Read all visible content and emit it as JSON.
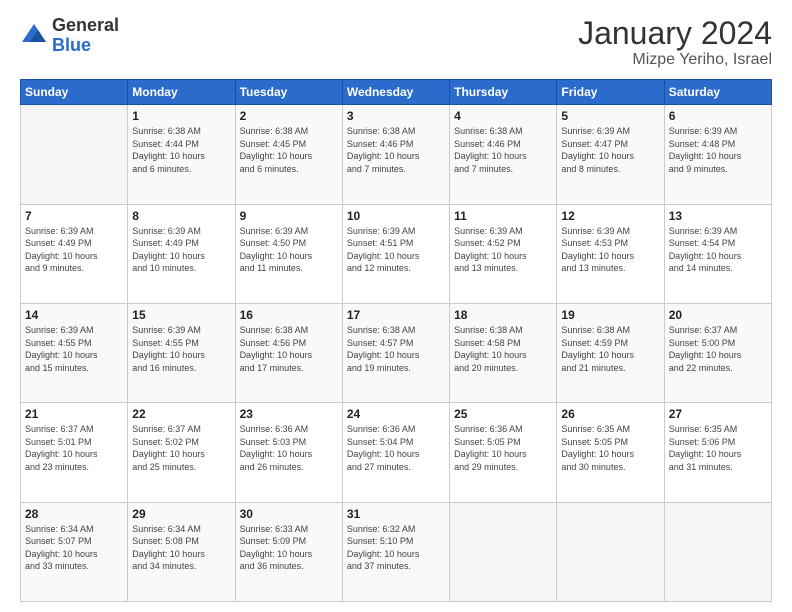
{
  "logo": {
    "general": "General",
    "blue": "Blue"
  },
  "title": {
    "month_year": "January 2024",
    "location": "Mizpe Yeriho, Israel"
  },
  "days_of_week": [
    "Sunday",
    "Monday",
    "Tuesday",
    "Wednesday",
    "Thursday",
    "Friday",
    "Saturday"
  ],
  "weeks": [
    [
      {
        "day": "",
        "info": ""
      },
      {
        "day": "1",
        "info": "Sunrise: 6:38 AM\nSunset: 4:44 PM\nDaylight: 10 hours\nand 6 minutes."
      },
      {
        "day": "2",
        "info": "Sunrise: 6:38 AM\nSunset: 4:45 PM\nDaylight: 10 hours\nand 6 minutes."
      },
      {
        "day": "3",
        "info": "Sunrise: 6:38 AM\nSunset: 4:46 PM\nDaylight: 10 hours\nand 7 minutes."
      },
      {
        "day": "4",
        "info": "Sunrise: 6:38 AM\nSunset: 4:46 PM\nDaylight: 10 hours\nand 7 minutes."
      },
      {
        "day": "5",
        "info": "Sunrise: 6:39 AM\nSunset: 4:47 PM\nDaylight: 10 hours\nand 8 minutes."
      },
      {
        "day": "6",
        "info": "Sunrise: 6:39 AM\nSunset: 4:48 PM\nDaylight: 10 hours\nand 9 minutes."
      }
    ],
    [
      {
        "day": "7",
        "info": "Sunrise: 6:39 AM\nSunset: 4:49 PM\nDaylight: 10 hours\nand 9 minutes."
      },
      {
        "day": "8",
        "info": "Sunrise: 6:39 AM\nSunset: 4:49 PM\nDaylight: 10 hours\nand 10 minutes."
      },
      {
        "day": "9",
        "info": "Sunrise: 6:39 AM\nSunset: 4:50 PM\nDaylight: 10 hours\nand 11 minutes."
      },
      {
        "day": "10",
        "info": "Sunrise: 6:39 AM\nSunset: 4:51 PM\nDaylight: 10 hours\nand 12 minutes."
      },
      {
        "day": "11",
        "info": "Sunrise: 6:39 AM\nSunset: 4:52 PM\nDaylight: 10 hours\nand 13 minutes."
      },
      {
        "day": "12",
        "info": "Sunrise: 6:39 AM\nSunset: 4:53 PM\nDaylight: 10 hours\nand 13 minutes."
      },
      {
        "day": "13",
        "info": "Sunrise: 6:39 AM\nSunset: 4:54 PM\nDaylight: 10 hours\nand 14 minutes."
      }
    ],
    [
      {
        "day": "14",
        "info": "Sunrise: 6:39 AM\nSunset: 4:55 PM\nDaylight: 10 hours\nand 15 minutes."
      },
      {
        "day": "15",
        "info": "Sunrise: 6:39 AM\nSunset: 4:55 PM\nDaylight: 10 hours\nand 16 minutes."
      },
      {
        "day": "16",
        "info": "Sunrise: 6:38 AM\nSunset: 4:56 PM\nDaylight: 10 hours\nand 17 minutes."
      },
      {
        "day": "17",
        "info": "Sunrise: 6:38 AM\nSunset: 4:57 PM\nDaylight: 10 hours\nand 19 minutes."
      },
      {
        "day": "18",
        "info": "Sunrise: 6:38 AM\nSunset: 4:58 PM\nDaylight: 10 hours\nand 20 minutes."
      },
      {
        "day": "19",
        "info": "Sunrise: 6:38 AM\nSunset: 4:59 PM\nDaylight: 10 hours\nand 21 minutes."
      },
      {
        "day": "20",
        "info": "Sunrise: 6:37 AM\nSunset: 5:00 PM\nDaylight: 10 hours\nand 22 minutes."
      }
    ],
    [
      {
        "day": "21",
        "info": "Sunrise: 6:37 AM\nSunset: 5:01 PM\nDaylight: 10 hours\nand 23 minutes."
      },
      {
        "day": "22",
        "info": "Sunrise: 6:37 AM\nSunset: 5:02 PM\nDaylight: 10 hours\nand 25 minutes."
      },
      {
        "day": "23",
        "info": "Sunrise: 6:36 AM\nSunset: 5:03 PM\nDaylight: 10 hours\nand 26 minutes."
      },
      {
        "day": "24",
        "info": "Sunrise: 6:36 AM\nSunset: 5:04 PM\nDaylight: 10 hours\nand 27 minutes."
      },
      {
        "day": "25",
        "info": "Sunrise: 6:36 AM\nSunset: 5:05 PM\nDaylight: 10 hours\nand 29 minutes."
      },
      {
        "day": "26",
        "info": "Sunrise: 6:35 AM\nSunset: 5:05 PM\nDaylight: 10 hours\nand 30 minutes."
      },
      {
        "day": "27",
        "info": "Sunrise: 6:35 AM\nSunset: 5:06 PM\nDaylight: 10 hours\nand 31 minutes."
      }
    ],
    [
      {
        "day": "28",
        "info": "Sunrise: 6:34 AM\nSunset: 5:07 PM\nDaylight: 10 hours\nand 33 minutes."
      },
      {
        "day": "29",
        "info": "Sunrise: 6:34 AM\nSunset: 5:08 PM\nDaylight: 10 hours\nand 34 minutes."
      },
      {
        "day": "30",
        "info": "Sunrise: 6:33 AM\nSunset: 5:09 PM\nDaylight: 10 hours\nand 36 minutes."
      },
      {
        "day": "31",
        "info": "Sunrise: 6:32 AM\nSunset: 5:10 PM\nDaylight: 10 hours\nand 37 minutes."
      },
      {
        "day": "",
        "info": ""
      },
      {
        "day": "",
        "info": ""
      },
      {
        "day": "",
        "info": ""
      }
    ]
  ]
}
